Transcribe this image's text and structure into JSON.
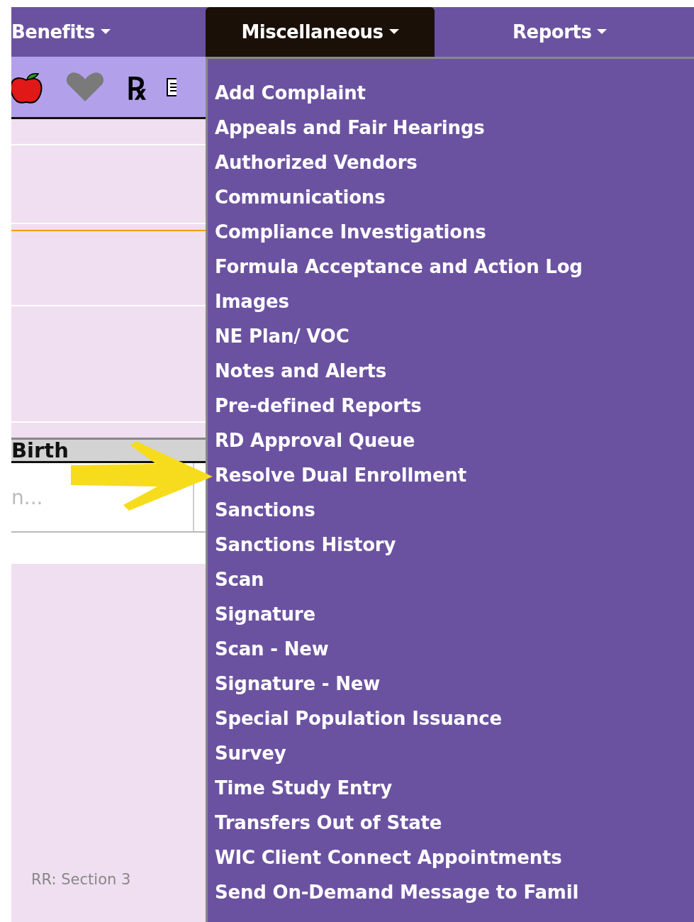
{
  "nav": [
    {
      "label": "Benefits",
      "selected": false
    },
    {
      "label": "Miscellaneous",
      "selected": true
    },
    {
      "label": "Reports",
      "selected": false
    }
  ],
  "toolbar": [
    {
      "kind": "apple"
    },
    {
      "kind": "heart"
    },
    {
      "kind": "rx",
      "glyph": "℞"
    },
    {
      "kind": "notes"
    }
  ],
  "grid": {
    "header": "Birth",
    "cell": "n..."
  },
  "footer": "RR: Section 3",
  "menu": [
    "Add Complaint",
    "Appeals and Fair Hearings",
    "Authorized Vendors",
    "Communications",
    "Compliance Investigations",
    "Formula Acceptance and Action Log",
    "Images",
    "NE Plan/ VOC",
    "Notes and Alerts",
    "Pre-defined Reports",
    "RD Approval Queue",
    "Resolve Dual Enrollment",
    "Sanctions",
    "Sanctions History",
    "Scan",
    "Signature",
    "Scan - New",
    "Signature - New",
    "Special Population Issuance",
    "Survey",
    "Time Study Entry",
    "Transfers Out of State",
    "WIC Client Connect Appointments",
    "Send On-Demand Message to Famil"
  ]
}
